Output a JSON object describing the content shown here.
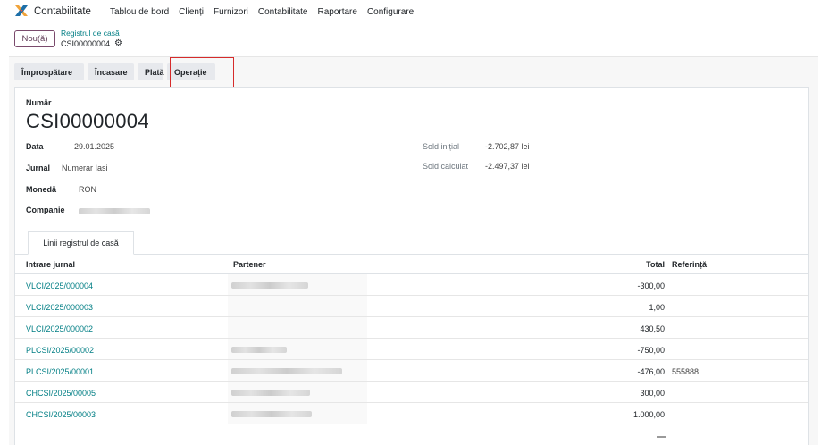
{
  "navbar": {
    "app_name": "Contabilitate",
    "menu": [
      "Tablou de bord",
      "Clienți",
      "Furnizori",
      "Contabilitate",
      "Raportare",
      "Configurare"
    ]
  },
  "control_panel": {
    "new_button": "Nou(ă)",
    "breadcrumb_parent": "Registrul de casă",
    "breadcrumb_current": "CSI00000004"
  },
  "header_buttons": [
    "Împrospătare",
    "Încasare",
    "Plată",
    "Operație"
  ],
  "form": {
    "number_label": "Număr",
    "number_value": "CSI00000004",
    "date_label": "Data",
    "date_value": "29.01.2025",
    "journal_label": "Jurnal",
    "journal_value": "Numerar Iasi",
    "currency_label": "Monedă",
    "currency_value": "RON",
    "company_label": "Companie",
    "initial_balance_label": "Sold inițial",
    "initial_balance_value": "-2.702,87 lei",
    "computed_balance_label": "Sold calculat",
    "computed_balance_value": "-2.497,37 lei"
  },
  "tab": {
    "label": "Linii registrul de casă"
  },
  "table": {
    "headers": {
      "journal_entry": "Intrare jurnal",
      "partner": "Partener",
      "total": "Total",
      "reference": "Referință"
    },
    "rows": [
      {
        "entry": "VLCI/2025/000004",
        "total": "-300,00",
        "reference": ""
      },
      {
        "entry": "VLCI/2025/000003",
        "total": "1,00",
        "reference": ""
      },
      {
        "entry": "VLCI/2025/000002",
        "total": "430,50",
        "reference": ""
      },
      {
        "entry": "PLCSI/2025/00002",
        "total": "-750,00",
        "reference": ""
      },
      {
        "entry": "PLCSI/2025/00001",
        "total": "-476,00",
        "reference": "555888"
      },
      {
        "entry": "CHCSI/2025/00005",
        "total": "300,00",
        "reference": ""
      },
      {
        "entry": "CHCSI/2025/00003",
        "total": "1.000,00",
        "reference": ""
      }
    ]
  },
  "colors": {
    "link": "#017e84",
    "brand": "#714b67",
    "highlight": "#d62b2b"
  }
}
